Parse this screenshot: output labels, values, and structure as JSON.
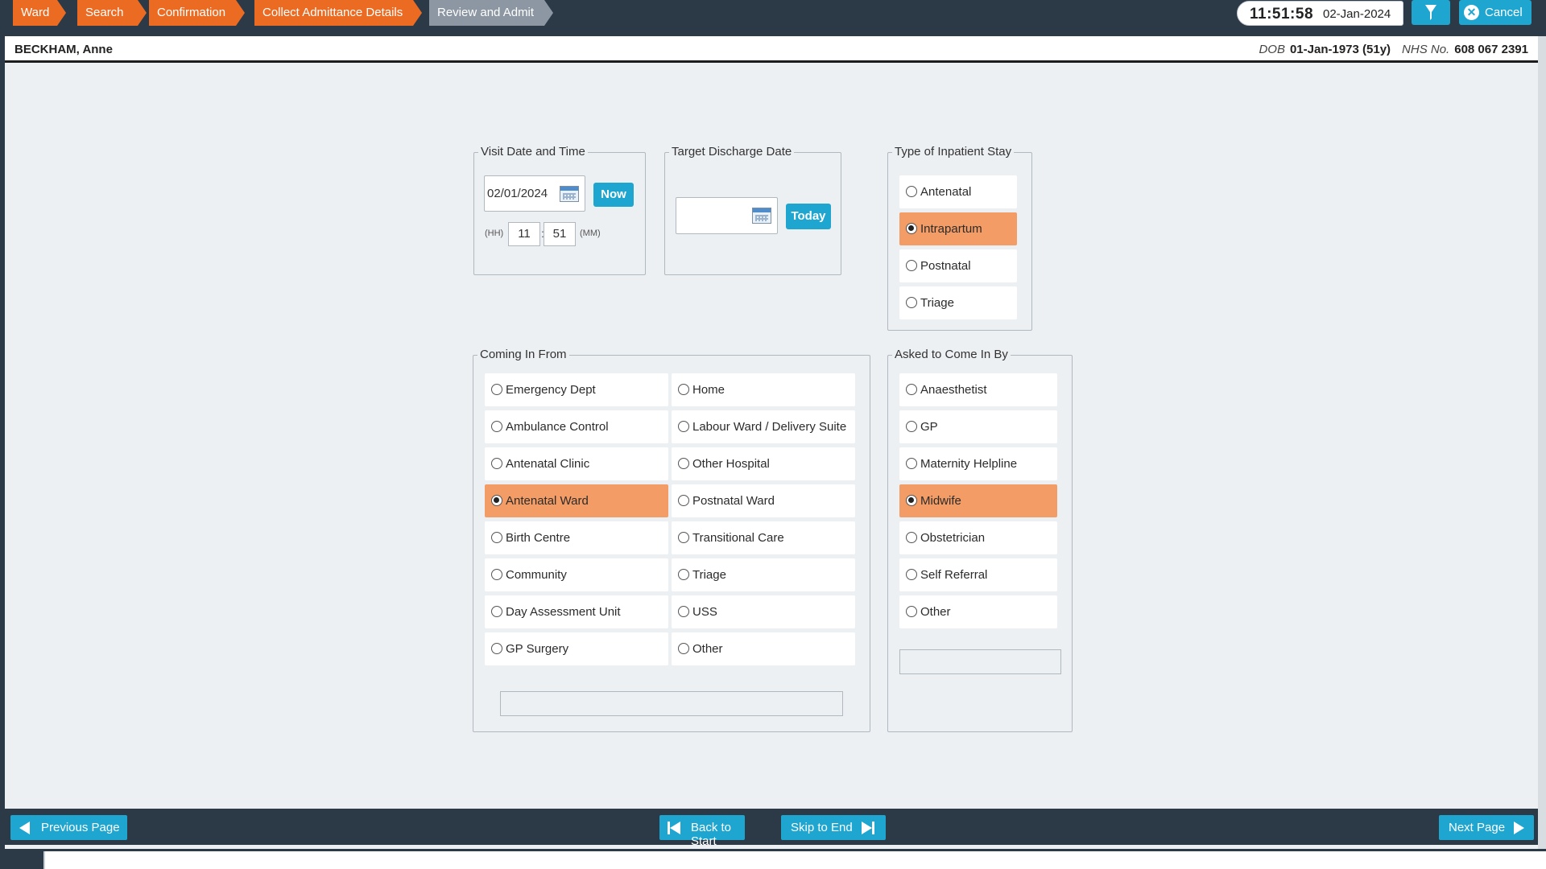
{
  "breadcrumb": [
    "Ward",
    "Search",
    "Confirmation",
    "Collect Admittance Details",
    "Review and Admit"
  ],
  "clock": {
    "time": "11:51:58",
    "date": "02-Jan-2024"
  },
  "header_buttons": {
    "filter_icon": "hourglass-icon",
    "cancel_label": "Cancel",
    "cancel_icon": "close-circle-icon"
  },
  "patient": {
    "name": "BECKHAM, Anne",
    "dob_label": "DOB",
    "dob_value": "01-Jan-1973 (51y)",
    "nhs_label": "NHS No.",
    "nhs_value": "608 067 2391"
  },
  "visit": {
    "legend": "Visit Date and Time",
    "date_value": "02/01/2024",
    "now_label": "Now",
    "hh_label": "(HH)",
    "hour": "11",
    "separator": ":",
    "minute": "51",
    "mm_label": "(MM)"
  },
  "discharge": {
    "legend": "Target Discharge Date",
    "date_value": "",
    "today_label": "Today"
  },
  "stay_type": {
    "legend": "Type of Inpatient Stay",
    "options": [
      "Antenatal",
      "Intrapartum",
      "Postnatal",
      "Triage"
    ],
    "selected": "Intrapartum"
  },
  "coming_from": {
    "legend": "Coming In From",
    "left_options": [
      "Emergency Dept",
      "Ambulance Control",
      "Antenatal Clinic",
      "Antenatal Ward",
      "Birth Centre",
      "Community",
      "Day Assessment Unit",
      "GP Surgery"
    ],
    "right_options": [
      "Home",
      "Labour Ward / Delivery Suite",
      "Other Hospital",
      "Postnatal Ward",
      "Transitional Care",
      "Triage",
      "USS",
      "Other"
    ],
    "selected": "Antenatal Ward",
    "other_text": ""
  },
  "asked_by": {
    "legend": "Asked to Come In By",
    "options": [
      "Anaesthetist",
      "GP",
      "Maternity Helpline",
      "Midwife",
      "Obstetrician",
      "Self Referral",
      "Other"
    ],
    "selected": "Midwife",
    "other_text": ""
  },
  "footer": {
    "previous": "Previous Page",
    "back_to_start": "Back to Start",
    "skip_to_end": "Skip to End",
    "next": "Next Page"
  },
  "colors": {
    "accent_orange": "#ec6b23",
    "selected_option": "#f39c65",
    "button_blue": "#1ea6d1",
    "bar_dark": "#2c3a47"
  }
}
